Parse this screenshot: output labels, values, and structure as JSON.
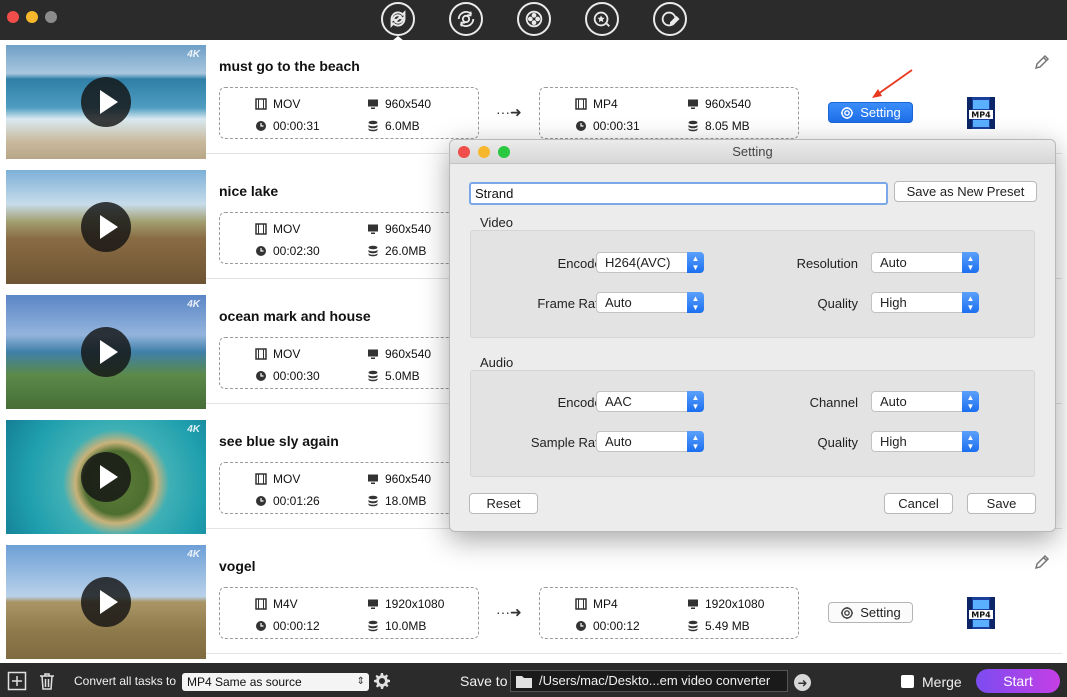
{
  "window": {
    "nav_icons": [
      "convert-icon",
      "cloud-sync-icon",
      "film-reel-icon",
      "film-star-icon",
      "film-edit-icon"
    ]
  },
  "videos": [
    {
      "title": "must go to the beach",
      "src": {
        "format": "MOV",
        "resolution": "960x540",
        "duration": "00:00:31",
        "size": "6.0MB"
      },
      "dst": {
        "format": "MP4",
        "resolution": "960x540",
        "duration": "00:00:31",
        "size": "8.05 MB"
      },
      "setting_label": "Setting",
      "badge": "4K"
    },
    {
      "title": "nice lake",
      "src": {
        "format": "MOV",
        "resolution": "960x540",
        "duration": "00:02:30",
        "size": "26.0MB"
      },
      "badge": ""
    },
    {
      "title": "ocean mark and house",
      "src": {
        "format": "MOV",
        "resolution": "960x540",
        "duration": "00:00:30",
        "size": "5.0MB"
      },
      "badge": "4K"
    },
    {
      "title": "see blue sly again",
      "src": {
        "format": "MOV",
        "resolution": "960x540",
        "duration": "00:01:26",
        "size": "18.0MB"
      },
      "badge": "4K"
    },
    {
      "title": "vogel",
      "src": {
        "format": "M4V",
        "resolution": "1920x1080",
        "duration": "00:00:12",
        "size": "10.0MB"
      },
      "dst": {
        "format": "MP4",
        "resolution": "1920x1080",
        "duration": "00:00:12",
        "size": "5.49 MB"
      },
      "setting_label": "Setting",
      "badge": "4K"
    }
  ],
  "mp4_label": "MP4",
  "bottom": {
    "convert_all_label": "Convert all tasks to",
    "preset_value": "MP4 Same as source",
    "save_to_label": "Save to",
    "path": "/Users/mac/Deskto...em video converter",
    "merge_label": "Merge",
    "start_label": "Start"
  },
  "dialog": {
    "title": "Setting",
    "preset_name": "Strand",
    "save_preset_label": "Save as New Preset",
    "video_label": "Video",
    "audio_label": "Audio",
    "video": {
      "encoder_label": "Encoder",
      "encoder_value": "H264(AVC)",
      "framerate_label": "Frame Rate",
      "framerate_value": "Auto",
      "resolution_label": "Resolution",
      "resolution_value": "Auto",
      "quality_label": "Quality",
      "quality_value": "High"
    },
    "audio": {
      "encoder_label": "Encoder",
      "encoder_value": "AAC",
      "samplerate_label": "Sample Rate",
      "samplerate_value": "Auto",
      "channel_label": "Channel",
      "channel_value": "Auto",
      "quality_label": "Quality",
      "quality_value": "High"
    },
    "reset_label": "Reset",
    "cancel_label": "Cancel",
    "save_label": "Save"
  }
}
